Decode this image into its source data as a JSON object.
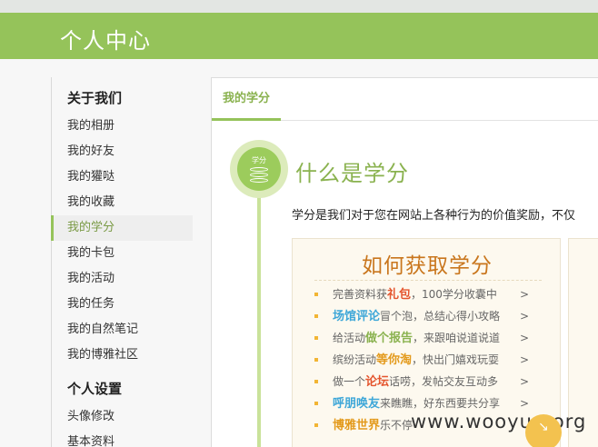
{
  "header": {
    "title": "个人中心"
  },
  "sidebar": {
    "section1": "关于我们",
    "items1": [
      "我的相册",
      "我的好友",
      "我的獾哒",
      "我的收藏",
      "我的学分",
      "我的卡包",
      "我的活动",
      "我的任务",
      "我的自然笔记",
      "我的博雅社区"
    ],
    "active_index": 4,
    "section2": "个人设置",
    "items2": [
      "头像修改",
      "基本资料"
    ]
  },
  "tabs": [
    {
      "label": "我的学分"
    }
  ],
  "content": {
    "badge_label": "学分",
    "title": "什么是学分",
    "description": "学分是我们对于您在网站上各种行为的价值奖励，不仅",
    "card_title": "如何获取学分",
    "items": [
      {
        "pre": "完善资料获",
        "hl": "礼包",
        "hl_color": "red",
        "post": "，100学分收囊中"
      },
      {
        "pre": "",
        "hl": "场馆评论",
        "hl_color": "blue",
        "post": "冒个泡，总结心得小攻略"
      },
      {
        "pre": "给活动",
        "hl": "做个报告",
        "hl_color": "green",
        "post": "，来跟咱说道说道"
      },
      {
        "pre": "缤纷活动",
        "hl": "等你淘",
        "hl_color": "orange",
        "post": "，快出门嬉戏玩耍"
      },
      {
        "pre": "做一个",
        "hl": "论坛",
        "hl_color": "red",
        "post": "话唠，发帖交友互动多"
      },
      {
        "pre": "",
        "hl": "呼朋唤友",
        "hl_color": "blue",
        "post": "来瞧瞧，好东西要共分享"
      },
      {
        "pre": "",
        "hl": "博雅世界",
        "hl_color": "orange",
        "post": "乐不停"
      }
    ],
    "arrow": ">"
  },
  "watermark": "www.wooyun.org",
  "colors": {
    "brand_green": "#95c35a",
    "title_green": "#8ab24f",
    "card_title_orange": "#c9761d"
  }
}
